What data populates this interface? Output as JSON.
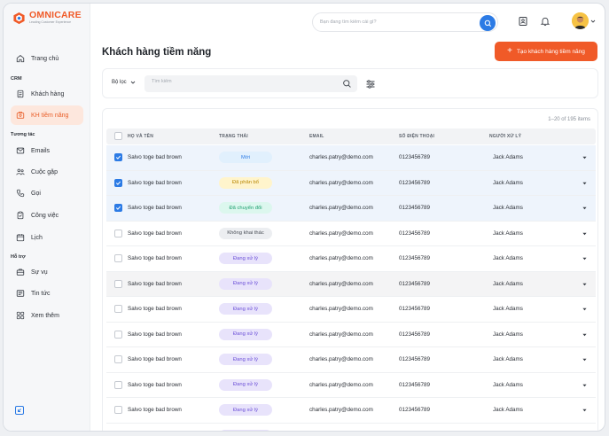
{
  "brand": {
    "name_a": "OMNI",
    "name_b": "CARE",
    "tagline": "Leading Customer Experience"
  },
  "colors": {
    "accent": "#f05a28",
    "primary": "#2c7be5"
  },
  "topbar": {
    "search_placeholder": "Bạn đang tìm kiếm cái gì?"
  },
  "sidebar": {
    "home": "Trang chủ",
    "crm_section": "CRM",
    "customers": "Khách hàng",
    "leads": "KH tiềm năng",
    "interaction_section": "Tương tác",
    "emails": "Emails",
    "meetings": "Cuộc gặp",
    "calls": "Gọi",
    "tasks": "Công việc",
    "calendar": "Lịch",
    "support_section": "Hỗ trợ",
    "cases": "Sự vụ",
    "news": "Tin tức",
    "more": "Xem thêm"
  },
  "page": {
    "title": "Khách hàng tiềm năng",
    "create_button": "Tạo khách hàng tiềm năng"
  },
  "filter": {
    "dropdown_label": "Bộ lọc",
    "search_placeholder": "Tìm kiếm"
  },
  "table": {
    "count": "1–20 of 195 items",
    "headers": {
      "name": "HỌ VÀ TÊN",
      "status": "TRẠNG THÁI",
      "email": "EMAIL",
      "phone": "SỐ ĐIỆN THOẠI",
      "owner": "NGƯỜI XỬ LÝ"
    },
    "rows": [
      {
        "name": "Salvo toge bad brown",
        "status": "Mới",
        "email": "charles.patry@demo.com",
        "phone": "0123456789",
        "owner": "Jack Adams",
        "checked": true
      },
      {
        "name": "Salvo toge bad brown",
        "status": "Đã phân bổ",
        "email": "charles.patry@demo.com",
        "phone": "0123456789",
        "owner": "Jack Adams",
        "checked": true
      },
      {
        "name": "Salvo toge bad brown",
        "status": "Đã chuyển đổi",
        "email": "charles.patry@demo.com",
        "phone": "0123456789",
        "owner": "Jack Adams",
        "checked": true
      },
      {
        "name": "Salvo toge bad brown",
        "status": "Không khai thác",
        "email": "charles.patry@demo.com",
        "phone": "0123456789",
        "owner": "Jack Adams",
        "checked": false
      },
      {
        "name": "Salvo toge bad brown",
        "status": "Đang xử lý",
        "email": "charles.patry@demo.com",
        "phone": "0123456789",
        "owner": "Jack Adams",
        "checked": false
      },
      {
        "name": "Salvo toge bad brown",
        "status": "Đang xử lý",
        "email": "charles.patry@demo.com",
        "phone": "0123456789",
        "owner": "Jack Adams",
        "checked": false
      },
      {
        "name": "Salvo toge bad brown",
        "status": "Đang xử lý",
        "email": "charles.patry@demo.com",
        "phone": "0123456789",
        "owner": "Jack Adams",
        "checked": false
      },
      {
        "name": "Salvo toge bad brown",
        "status": "Đang xử lý",
        "email": "charles.patry@demo.com",
        "phone": "0123456789",
        "owner": "Jack Adams",
        "checked": false
      },
      {
        "name": "Salvo toge bad brown",
        "status": "Đang xử lý",
        "email": "charles.patry@demo.com",
        "phone": "0123456789",
        "owner": "Jack Adams",
        "checked": false
      },
      {
        "name": "Salvo toge bad brown",
        "status": "Đang xử lý",
        "email": "charles.patry@demo.com",
        "phone": "0123456789",
        "owner": "Jack Adams",
        "checked": false
      },
      {
        "name": "Salvo toge bad brown",
        "status": "Đang xử lý",
        "email": "charles.patry@demo.com",
        "phone": "0123456789",
        "owner": "Jack Adams",
        "checked": false
      },
      {
        "name": "Salvo toge bad brown",
        "status": "Đang xử lý",
        "email": "charles.patry@demo.com",
        "phone": "0123456789",
        "owner": "Jack Adams",
        "checked": false
      }
    ],
    "status_styles": {
      "Mới": {
        "bg": "#e1f0fd",
        "fg": "#2c7be5"
      },
      "Đã phân bổ": {
        "bg": "#fff4cc",
        "fg": "#b88600"
      },
      "Đã chuyển đổi": {
        "bg": "#dcf7ee",
        "fg": "#1b9e6e"
      },
      "Không khai thác": {
        "bg": "#eceef1",
        "fg": "#4a4f57"
      },
      "Đang xử lý": {
        "bg": "#e8e3fb",
        "fg": "#6b4fd8"
      }
    }
  }
}
